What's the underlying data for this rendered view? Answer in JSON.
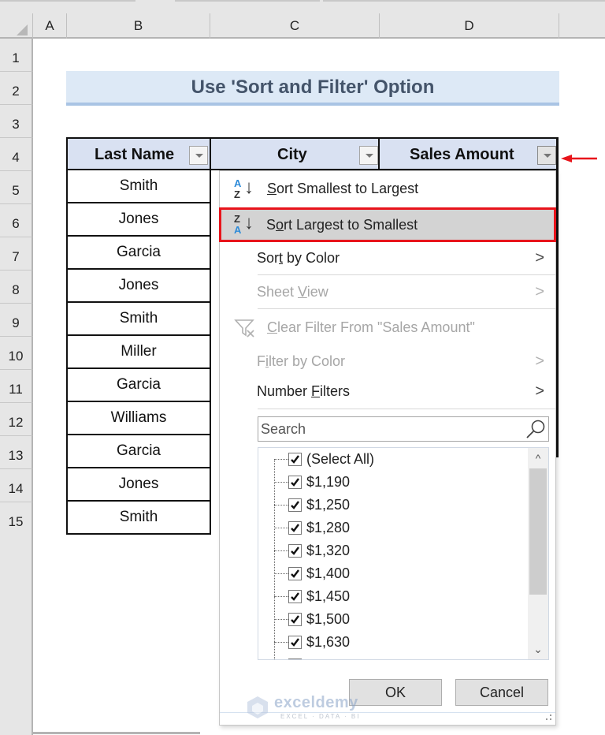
{
  "columns": [
    "A",
    "B",
    "C",
    "D"
  ],
  "rows": [
    "1",
    "2",
    "3",
    "4",
    "5",
    "6",
    "7",
    "8",
    "9",
    "10",
    "11",
    "12",
    "13",
    "14",
    "15"
  ],
  "title": "Use 'Sort and Filter' Option",
  "table": {
    "headers": [
      "Last Name",
      "City",
      "Sales Amount"
    ],
    "last_names": [
      "Smith",
      "Jones",
      "Garcia",
      "Jones",
      "Smith",
      "Miller",
      "Garcia",
      "Williams",
      "Garcia",
      "Jones",
      "Smith"
    ]
  },
  "filter_menu": {
    "sort_asc": {
      "pre": "",
      "ul": "S",
      "post": "ort Smallest to Largest",
      "icon_top": "A",
      "icon_bottom": "Z"
    },
    "sort_desc": {
      "pre": "S",
      "ul": "o",
      "post": "rt Largest to Smallest",
      "icon_top": "Z",
      "icon_bottom": "A"
    },
    "sort_color": {
      "pre": "Sor",
      "ul": "t",
      "post": " by Color"
    },
    "sheet_view": {
      "pre": "Sheet ",
      "ul": "V",
      "post": "iew"
    },
    "clear_filter": {
      "pre": "",
      "ul": "C",
      "post": "lear Filter From \"Sales Amount\""
    },
    "filter_color": {
      "pre": "F",
      "ul": "i",
      "post": "lter by Color"
    },
    "number_filters": {
      "pre": "Number ",
      "ul": "F",
      "post": "ilters"
    },
    "chevron": ">",
    "search_placeholder": "Search",
    "list": [
      "(Select All)",
      "$1,190",
      "$1,250",
      "$1,280",
      "$1,320",
      "$1,400",
      "$1,450",
      "$1,500",
      "$1,630"
    ],
    "ok": "OK",
    "cancel": "Cancel"
  },
  "watermark": {
    "name": "exceldemy",
    "tagline": "EXCEL · DATA · BI"
  },
  "colors": {
    "highlight_border": "#e8141b",
    "header_fill": "#d9e1f2",
    "title_fill": "#dde9f6",
    "arrow": "#e8141b"
  }
}
